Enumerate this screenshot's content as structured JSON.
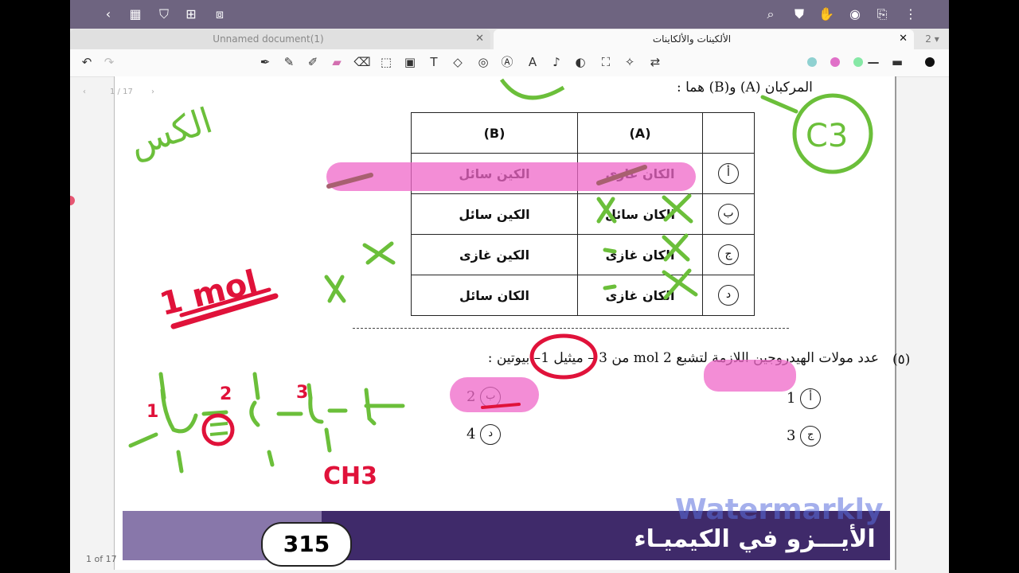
{
  "tabs": {
    "inactive_title": "Unnamed document(1)",
    "active_title": "الألكينات والألكاينات",
    "close_glyph": "✕",
    "count": "2"
  },
  "nav": {
    "page_indicator": "1 / 17"
  },
  "page_count": "1 of 17",
  "question4": {
    "stem": "المركبان (A) و(B) هما :",
    "col_b_header": "(B)",
    "col_a_header": "(A)",
    "rows": [
      {
        "label": "أ",
        "a": "الكان غازى",
        "b": "الكين سائل"
      },
      {
        "label": "ب",
        "a": "الكان سائل",
        "b": "الكين سائل"
      },
      {
        "label": "ج",
        "a": "الكان غازى",
        "b": "الكين غازى"
      },
      {
        "label": "د",
        "a": "الكان غازى",
        "b": "الكان سائل"
      }
    ]
  },
  "question5": {
    "number": "(٥)",
    "stem": "عدد مولات الهيدروجين اللازمة لتشبع 2 mol من 3 – ميثيل 1– بيوتين :",
    "options": [
      {
        "label": "أ",
        "value": "1"
      },
      {
        "label": "ب",
        "value": "2"
      },
      {
        "label": "ج",
        "value": "3"
      },
      {
        "label": "د",
        "value": "4"
      }
    ]
  },
  "footer": {
    "page_number": "315",
    "book_title": "الأيـــزو في الكيميـاء"
  },
  "watermark": "Watermarkly",
  "annotations": {
    "c3": "C3",
    "one_mol": "1 mol",
    "ch3": "CH3",
    "num1": "1",
    "num2": "2",
    "num3": "3",
    "topleft": "الكس"
  },
  "colors": {
    "topbar": "#6e6480",
    "ink_green": "#6bbf3a",
    "ink_pink": "#ef67c8",
    "ink_red": "#e0123a"
  },
  "icons": [
    "back-icon",
    "grid-icon",
    "bookmark-icon",
    "add-page-icon",
    "crop-icon",
    "search-icon",
    "shirt-icon",
    "hand-icon",
    "eye-icon",
    "export-icon",
    "more-icon",
    "undo-icon",
    "redo-icon",
    "pen-icon",
    "pencil-icon",
    "fountain-pen-icon",
    "highlighter-icon",
    "eraser-icon",
    "lasso-icon",
    "image-icon",
    "text-icon",
    "shape-icon",
    "sticker-icon",
    "text-ai-icon",
    "ai-icon",
    "mic-icon",
    "ruler-icon",
    "scan-icon",
    "magic-icon",
    "translate-icon"
  ]
}
